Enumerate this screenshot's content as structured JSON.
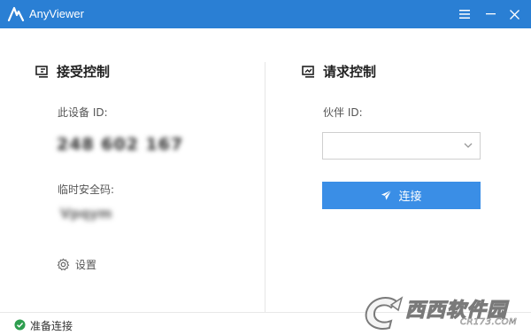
{
  "window": {
    "title": "AnyViewer",
    "accent_color": "#2a7fd4",
    "controls": [
      "menu-icon",
      "minimize-icon",
      "close-icon"
    ]
  },
  "receive": {
    "title": "接受控制",
    "icon": "remote-screen-icon",
    "device_id_label": "此设备 ID:",
    "device_id_value": "248 602 167",
    "temp_code_label": "临时安全码:",
    "temp_code_value": "Vpqym",
    "settings_label": "设置",
    "settings_icon": "gear-icon"
  },
  "request": {
    "title": "请求控制",
    "icon": "control-screen-icon",
    "partner_id_label": "伙伴 ID:",
    "partner_id_value": "",
    "connect_label": "连接",
    "connect_icon": "send-icon",
    "button_color": "#3a8ee6"
  },
  "status": {
    "text": "准备连接",
    "icon": "check-circle-icon",
    "color": "#2e9e4f"
  },
  "watermark": {
    "text": "西西软件园",
    "sub": "CR173.COM"
  }
}
